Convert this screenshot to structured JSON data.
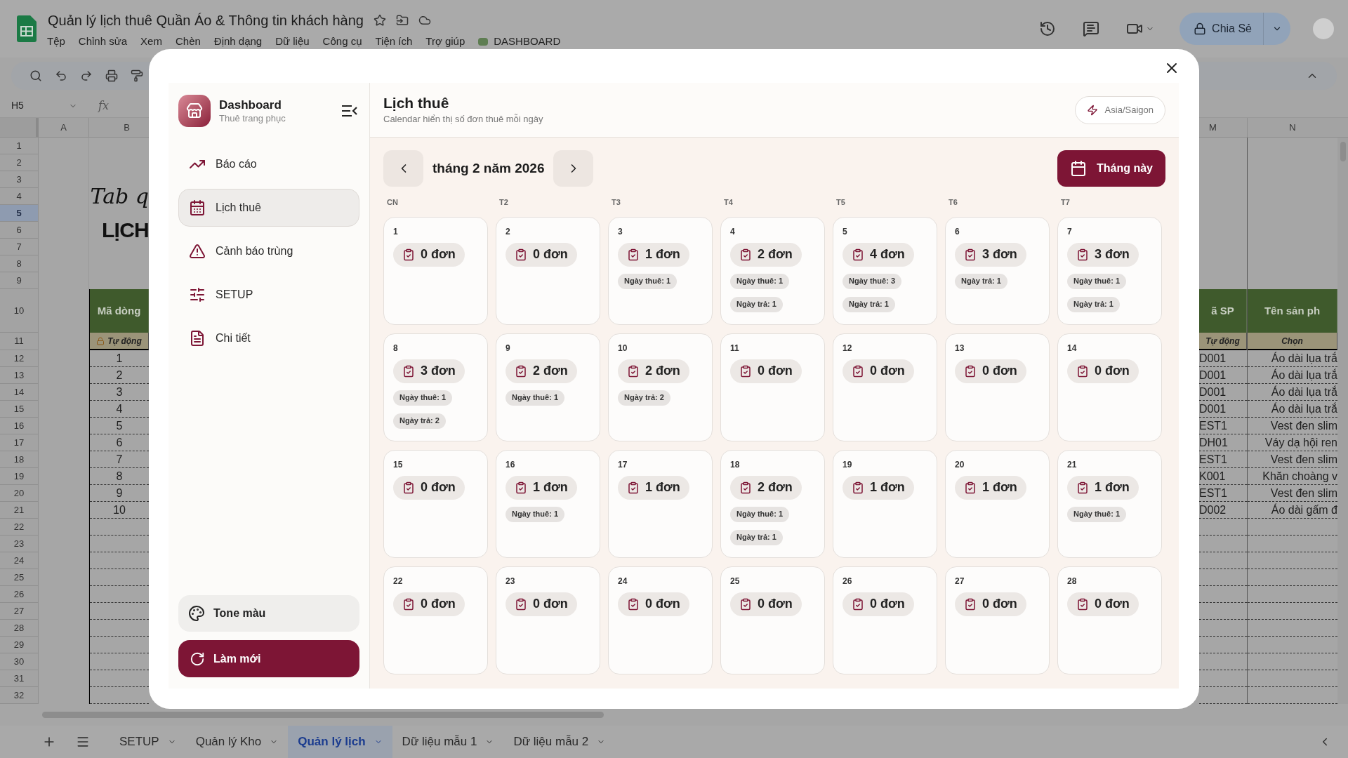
{
  "app": {
    "title": "Quản lý lịch thuê Quần Áo & Thông tin khách hàng",
    "menu": [
      "Tệp",
      "Chỉnh sửa",
      "Xem",
      "Chèn",
      "Định dạng",
      "Dữ liệu",
      "Công cụ",
      "Tiện ích",
      "Trợ giúp"
    ],
    "addon_menu": "DASHBOARD",
    "share_button": "Chia Sẻ"
  },
  "sheet": {
    "name_box": "H5",
    "fx": "fx",
    "columns_left": [
      "A",
      "B"
    ],
    "columns_right": [
      "M",
      "N"
    ],
    "rows": [
      {
        "number": "1",
        "selected": false,
        "kind": "plain"
      },
      {
        "number": "2",
        "selected": false,
        "kind": "plain"
      },
      {
        "number": "3",
        "selected": false,
        "kind": "plain"
      },
      {
        "number": "4",
        "selected": false,
        "kind": "script",
        "b": "Tab q"
      },
      {
        "number": "5",
        "selected": true,
        "kind": "plain"
      },
      {
        "number": "6",
        "selected": false,
        "kind": "heading",
        "b": "LỊCH"
      },
      {
        "number": "7",
        "selected": false,
        "kind": "plain"
      },
      {
        "number": "8",
        "selected": false,
        "kind": "plain"
      },
      {
        "number": "9",
        "selected": false,
        "kind": "plain"
      },
      {
        "number": "10",
        "selected": false,
        "kind": "header",
        "b": "Mã dòng",
        "m": "ã SP",
        "n": "Tên sản ph"
      },
      {
        "number": "11",
        "selected": false,
        "kind": "subheader",
        "b": "Tự động",
        "m": "Tự động",
        "n": "Chọn"
      },
      {
        "number": "12",
        "selected": false,
        "kind": "data",
        "b": "1",
        "m": "D001",
        "n": "Áo dài lụa trắ"
      },
      {
        "number": "13",
        "selected": false,
        "kind": "data",
        "b": "2",
        "m": "D001",
        "n": "Áo dài lụa trắ"
      },
      {
        "number": "14",
        "selected": false,
        "kind": "data",
        "b": "3",
        "m": "D001",
        "n": "Áo dài lụa trắ"
      },
      {
        "number": "15",
        "selected": false,
        "kind": "data",
        "b": "4",
        "m": "D001",
        "n": "Áo dài lụa trắ"
      },
      {
        "number": "16",
        "selected": false,
        "kind": "data",
        "b": "5",
        "m": "EST1",
        "n": "Vest đen slim"
      },
      {
        "number": "17",
        "selected": false,
        "kind": "data",
        "b": "6",
        "m": "DH01",
        "n": "Váy dạ hội ren"
      },
      {
        "number": "18",
        "selected": false,
        "kind": "data",
        "b": "7",
        "m": "EST1",
        "n": "Vest đen slim"
      },
      {
        "number": "19",
        "selected": false,
        "kind": "data",
        "b": "8",
        "m": "K001",
        "n": "Khăn choàng v"
      },
      {
        "number": "20",
        "selected": false,
        "kind": "data",
        "b": "9",
        "m": "EST1",
        "n": "Vest đen slim"
      },
      {
        "number": "21",
        "selected": false,
        "kind": "data",
        "b": "10",
        "m": "D002",
        "n": "Áo dài gấm đ"
      },
      {
        "number": "22",
        "selected": false,
        "kind": "empty"
      },
      {
        "number": "23",
        "selected": false,
        "kind": "empty"
      },
      {
        "number": "24",
        "selected": false,
        "kind": "empty"
      },
      {
        "number": "25",
        "selected": false,
        "kind": "empty"
      },
      {
        "number": "26",
        "selected": false,
        "kind": "empty"
      },
      {
        "number": "27",
        "selected": false,
        "kind": "empty"
      },
      {
        "number": "28",
        "selected": false,
        "kind": "empty"
      },
      {
        "number": "29",
        "selected": false,
        "kind": "empty"
      },
      {
        "number": "30",
        "selected": false,
        "kind": "empty"
      },
      {
        "number": "31",
        "selected": false,
        "kind": "empty"
      },
      {
        "number": "32",
        "selected": false,
        "kind": "empty"
      }
    ],
    "tabs": [
      {
        "label": "SETUP",
        "selected": false
      },
      {
        "label": "Quản lý Kho",
        "selected": false
      },
      {
        "label": "Quản lý lịch",
        "selected": true
      },
      {
        "label": "Dữ liệu mẫu 1",
        "selected": false
      },
      {
        "label": "Dữ liệu mẫu 2",
        "selected": false
      }
    ]
  },
  "dashboard": {
    "brand": {
      "title": "Dashboard",
      "subtitle": "Thuê trang phục"
    },
    "nav": [
      {
        "label": "Báo cáo",
        "selected": false
      },
      {
        "label": "Lịch thuê",
        "selected": true
      },
      {
        "label": "Cảnh báo trùng",
        "selected": false
      },
      {
        "label": "SETUP",
        "selected": false
      },
      {
        "label": "Chi tiết",
        "selected": false
      }
    ],
    "tone_button": "Tone màu",
    "refresh_button": "Làm mới",
    "header": {
      "title": "Lịch thuê",
      "subtitle": "Calendar hiển thị số đơn thuê mỗi ngày",
      "timezone": "Asia/Saigon"
    },
    "calendar": {
      "month_label": "tháng 2 năm 2026",
      "today_button": "Tháng này",
      "weekdays": [
        "CN",
        "T2",
        "T3",
        "T4",
        "T5",
        "T6",
        "T7"
      ],
      "days": [
        {
          "day": "1",
          "count": "0 đơn"
        },
        {
          "day": "2",
          "count": "0 đơn"
        },
        {
          "day": "3",
          "count": "1 đơn",
          "tags": [
            "Ngày thuê: 1"
          ]
        },
        {
          "day": "4",
          "count": "2 đơn",
          "tags": [
            "Ngày thuê: 1",
            "Ngày trả: 1"
          ]
        },
        {
          "day": "5",
          "count": "4 đơn",
          "tags": [
            "Ngày thuê: 3",
            "Ngày trả: 1"
          ]
        },
        {
          "day": "6",
          "count": "3 đơn",
          "tags": [
            "Ngày trả: 1"
          ]
        },
        {
          "day": "7",
          "count": "3 đơn",
          "tags": [
            "Ngày thuê: 1",
            "Ngày trả: 1"
          ]
        },
        {
          "day": "8",
          "count": "3 đơn",
          "tags": [
            "Ngày thuê: 1",
            "Ngày trả: 2"
          ]
        },
        {
          "day": "9",
          "count": "2 đơn",
          "tags": [
            "Ngày thuê: 1"
          ]
        },
        {
          "day": "10",
          "count": "2 đơn",
          "tags": [
            "Ngày trả: 2"
          ]
        },
        {
          "day": "11",
          "count": "0 đơn"
        },
        {
          "day": "12",
          "count": "0 đơn"
        },
        {
          "day": "13",
          "count": "0 đơn"
        },
        {
          "day": "14",
          "count": "0 đơn"
        },
        {
          "day": "15",
          "count": "0 đơn"
        },
        {
          "day": "16",
          "count": "1 đơn",
          "tags": [
            "Ngày thuê: 1"
          ]
        },
        {
          "day": "17",
          "count": "1 đơn"
        },
        {
          "day": "18",
          "count": "2 đơn",
          "tags": [
            "Ngày thuê: 1",
            "Ngày trả: 1"
          ]
        },
        {
          "day": "19",
          "count": "1 đơn"
        },
        {
          "day": "20",
          "count": "1 đơn"
        },
        {
          "day": "21",
          "count": "1 đơn",
          "tags": [
            "Ngày thuê: 1"
          ]
        },
        {
          "day": "22",
          "count": "0 đơn"
        },
        {
          "day": "23",
          "count": "0 đơn"
        },
        {
          "day": "24",
          "count": "0 đơn"
        },
        {
          "day": "25",
          "count": "0 đơn"
        },
        {
          "day": "26",
          "count": "0 đơn"
        },
        {
          "day": "27",
          "count": "0 đơn"
        },
        {
          "day": "28",
          "count": "0 đơn"
        }
      ]
    }
  }
}
